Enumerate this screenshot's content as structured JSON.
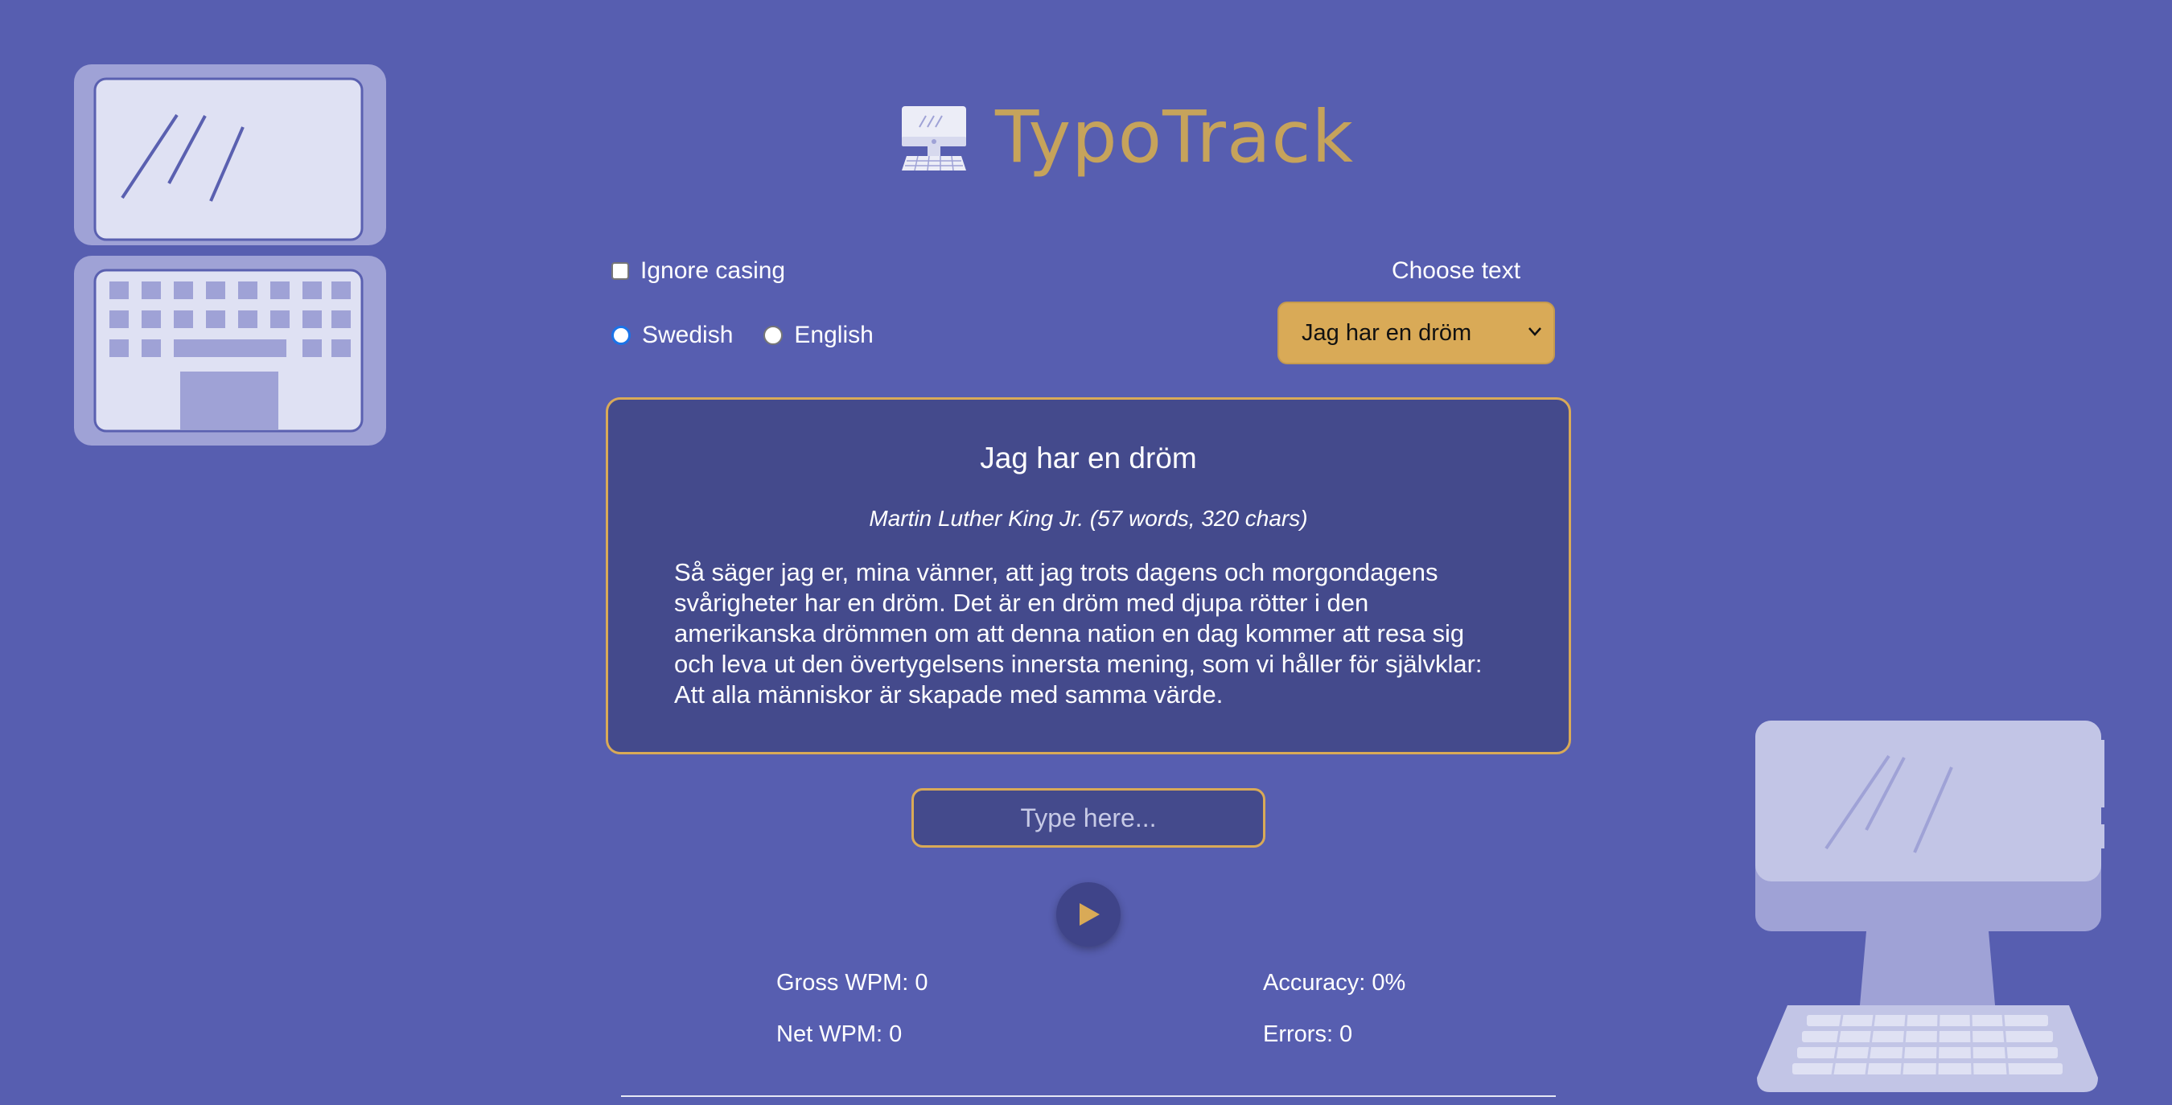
{
  "header": {
    "title": "TypoTrack",
    "logo_icon": "desktop-computer-icon"
  },
  "options": {
    "ignore_casing_label": "Ignore casing",
    "ignore_casing_checked": false,
    "languages": [
      {
        "label": "Swedish",
        "selected": true
      },
      {
        "label": "English",
        "selected": false
      }
    ]
  },
  "text_chooser": {
    "label": "Choose text",
    "selected": "Jag har en dröm"
  },
  "text_panel": {
    "title": "Jag har en dröm",
    "meta": "Martin Luther King Jr. (57 words, 320 chars)",
    "body": "Så säger jag er, mina vänner, att jag trots dagens och morgondagens svårigheter har en dröm. Det är en dröm med djupa rötter i den amerikanska drömmen om att denna nation en dag kommer att resa sig och leva ut den övertygelsens innersta mening, som vi håller för självklar: Att alla människor är skapade med samma värde."
  },
  "typing_input": {
    "placeholder": "Type here...",
    "value": ""
  },
  "stats": {
    "gross_wpm": "Gross WPM: 0",
    "net_wpm": "Net WPM: 0",
    "accuracy": "Accuracy: 0%",
    "errors": "Errors: 0"
  },
  "colors": {
    "background": "#575EB0",
    "accent": "#D9AA57",
    "title": "#C6A35B",
    "panel": "#444A8C"
  }
}
